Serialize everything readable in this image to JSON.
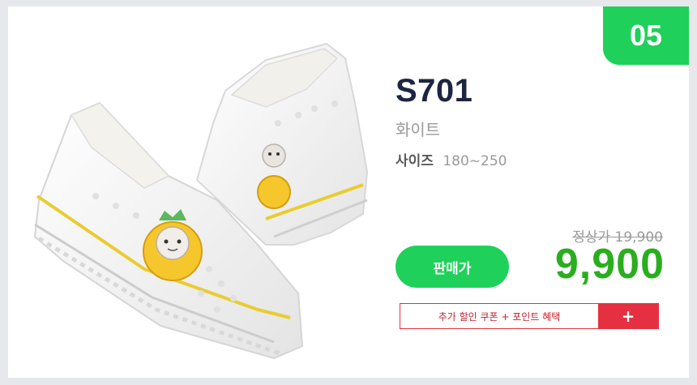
{
  "badge": {
    "number": "05"
  },
  "product": {
    "name": "S701",
    "color": "화이트",
    "size_label": "사이즈",
    "size_range": "180~250",
    "image_icon": "shoe-image"
  },
  "pricing": {
    "regular_label": "정상가 19,900",
    "sale_button_label": "판매가",
    "sale_price": "9,900"
  },
  "coupon": {
    "label": "추가 할인 쿠폰 + 포인트 혜택",
    "plus_icon": "+"
  },
  "colors": {
    "accent_green": "#1fd15a",
    "price_green": "#2aae1e",
    "coupon_red": "#e53041",
    "title_navy": "#1c2541"
  }
}
